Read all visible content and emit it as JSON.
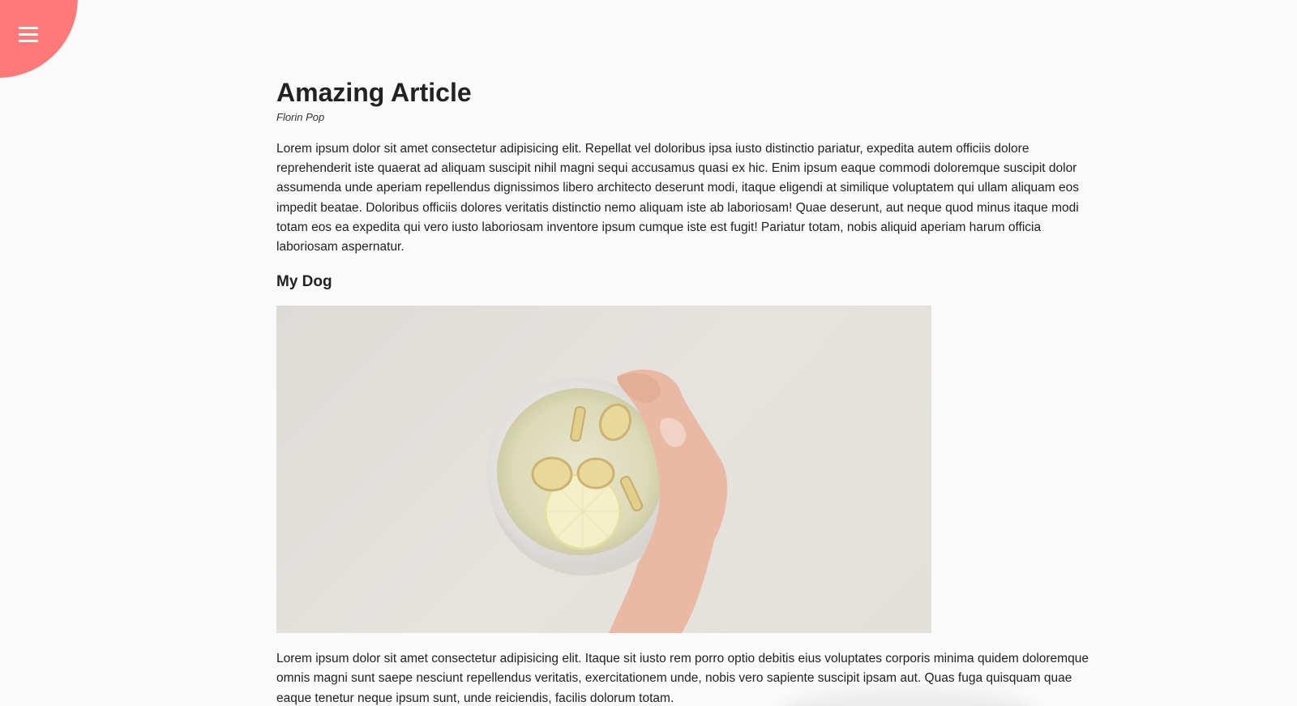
{
  "menu": {
    "icon": "hamburger-menu-icon",
    "color": "#ff7979"
  },
  "article": {
    "title": "Amazing Article",
    "author": "Florin Pop",
    "paragraph_1": "Lorem ipsum dolor sit amet consectetur adipisicing elit. Repellat vel doloribus ipsa iusto distinctio pariatur, expedita autem officiis dolore reprehenderit iste quaerat ad aliquam suscipit nihil magni sequi accusamus quasi ex hic. Enim ipsum eaque commodi doloremque suscipit dolor assumenda unde aperiam repellendus dignissimos libero architecto deserunt modi, itaque eligendi at similique voluptatem qui ullam aliquam eos impedit beatae. Doloribus officiis dolores veritatis distinctio nemo aliquam iste ab laboriosam! Quae deserunt, aut neque quod minus itaque modi totam eos ea expedita qui vero iusto laboriosam inventore ipsum cumque iste est fugit! Pariatur totam, nobis aliquid aperiam harum officia laboriosam aspernatur.",
    "subheading": "My Dog",
    "paragraph_2": "Lorem ipsum dolor sit amet consectetur adipisicing elit. Itaque sit iusto rem porro optio debitis eius voluptates corporis minima quidem doloremque omnis magni sunt saepe nesciunt repellendus veritatis, exercitationem unde, nobis vero sapiente suscipit ipsam aut. Quas fuga quisquam quae eaque tenetur neque ipsum sunt, unde reiciendis, facilis dolorum totam."
  }
}
